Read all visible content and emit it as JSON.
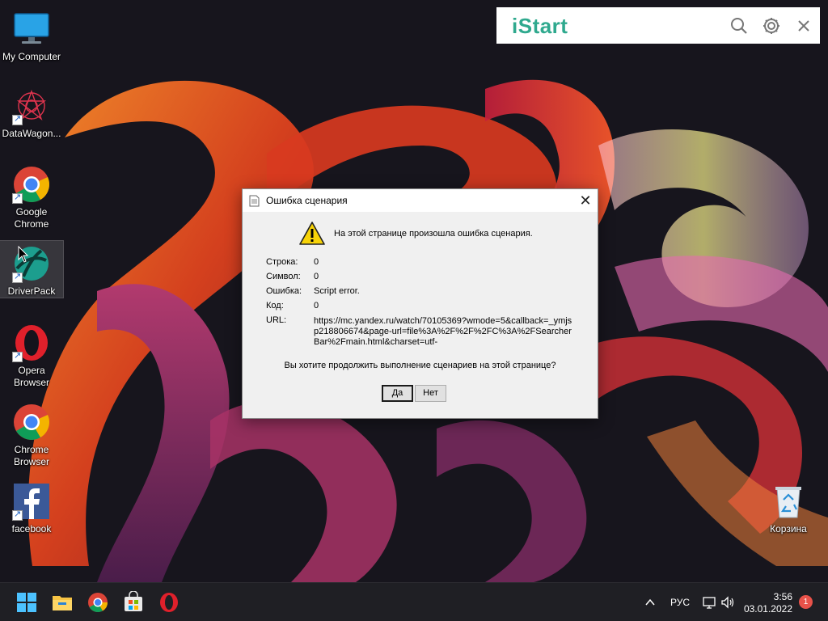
{
  "desktop": {
    "icons": [
      {
        "label": "My Computer",
        "icon": "monitor-icon"
      },
      {
        "label": "DataWagon...",
        "icon": "datawagon-icon"
      },
      {
        "label": "Google Chrome",
        "icon": "chrome-icon"
      },
      {
        "label": "DriverPack",
        "icon": "driverpack-icon"
      },
      {
        "label": "Opera Browser",
        "icon": "opera-icon"
      },
      {
        "label": "Chrome Browser",
        "icon": "chrome-browser-icon"
      },
      {
        "label": "facebook",
        "icon": "facebook-icon"
      },
      {
        "label": "Корзина",
        "icon": "recycle-bin-icon"
      }
    ]
  },
  "istart": {
    "logo": "iStart",
    "buttons": [
      "search-icon",
      "gear-icon",
      "close-icon"
    ]
  },
  "dialog": {
    "title": "Ошибка сценария",
    "message": "На этой странице произошла ошибка сценария.",
    "rows": [
      {
        "label": "Строка:",
        "value": "0"
      },
      {
        "label": "Символ:",
        "value": "0"
      },
      {
        "label": "Ошибка:",
        "value": "Script error."
      },
      {
        "label": "Код:",
        "value": "0"
      }
    ],
    "url_label": "URL:",
    "url_value": "https://mc.yandex.ru/watch/70105369?wmode=5&callback=_ymjsp218806674&page-url=file%3A%2F%2F%2FC%3A%2FSearcherBar%2Fmain.html&charset=utf-",
    "question": "Вы хотите продолжить выполнение сценариев на этой странице?",
    "yes_label": "Да",
    "no_label": "Нет"
  },
  "taskbar": {
    "apps": [
      "windows-start-icon",
      "file-explorer-icon",
      "chrome-taskbar-icon",
      "store-icon",
      "opera-taskbar-icon"
    ],
    "language": "РУС",
    "time": "3:56",
    "date": "03.01.2022",
    "notifications": "1"
  },
  "colors": {
    "istart_accent": "#2fa98e",
    "dialog_bg": "#f0f0f0",
    "taskbar_bg": "#1f1f24",
    "badge": "#e8524a"
  }
}
